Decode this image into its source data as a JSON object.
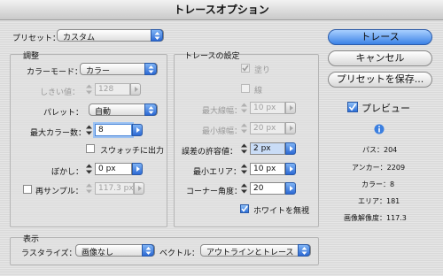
{
  "window": {
    "title": "トレースオプション"
  },
  "preset": {
    "label": "プリセット：",
    "value": "カスタム"
  },
  "adjust": {
    "title": "調整",
    "color_mode_label": "カラーモード：",
    "color_mode": "カラー",
    "threshold_label": "しきい値：",
    "threshold": "128",
    "palette_label": "パレット：",
    "palette": "自動",
    "max_colors_label": "最大カラー数：",
    "max_colors": "8",
    "swatch_label": "スウォッチに出力",
    "blur_label": "ぼかし：",
    "blur": "0 px",
    "resample_label": "再サンプル：",
    "resample": "117.3 px"
  },
  "trace": {
    "title": "トレースの設定",
    "fill_label": "塗り",
    "stroke_label": "線",
    "max_stroke_label": "最大線幅：",
    "max_stroke": "10 px",
    "min_stroke_label": "最小線幅：",
    "min_stroke": "20 px",
    "tolerance_label": "誤差の許容値：",
    "tolerance": "2 px",
    "min_area_label": "最小エリア：",
    "min_area": "10 px",
    "corner_label": "コーナー角度：",
    "corner": "20",
    "ignore_white_label": "ホワイトを無視"
  },
  "buttons": {
    "trace": "トレース",
    "cancel": "キャンセル",
    "save_preset": "プリセットを保存..."
  },
  "preview": {
    "label": "プレビュー"
  },
  "info": {
    "paths": "パス：204",
    "anchors": "アンカー：2209",
    "colors": "カラー：8",
    "areas": "エリア：181",
    "resolution": "画像解像度：117.3"
  },
  "display": {
    "title": "表示",
    "raster_label": "ラスタライズ：",
    "raster": "画像なし",
    "vector_label": "ベクトル：",
    "vector": "アウトラインとトレース"
  },
  "colors": {
    "accent": "#2c69d4",
    "window_bg": "#dcdcdc"
  }
}
